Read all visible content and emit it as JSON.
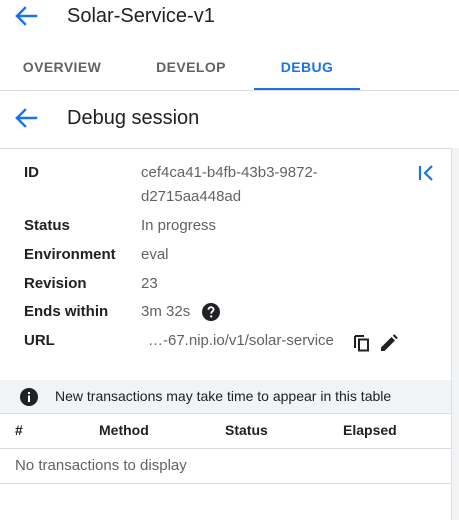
{
  "header": {
    "title": "Solar-Service-v1",
    "back_icon": "arrow-back-icon"
  },
  "tabs": [
    {
      "label": "OVERVIEW",
      "active": false
    },
    {
      "label": "DEVELOP",
      "active": false
    },
    {
      "label": "DEBUG",
      "active": true
    }
  ],
  "debug_session": {
    "title": "Debug session",
    "fields": {
      "id": {
        "label": "ID",
        "value": "cef4ca41-b4fb-43b3-9872-d2715aa448ad"
      },
      "status": {
        "label": "Status",
        "value": "In progress"
      },
      "environment": {
        "label": "Environment",
        "value": "eval"
      },
      "revision": {
        "label": "Revision",
        "value": "23"
      },
      "ends_within": {
        "label": "Ends within",
        "value": "3m 32s"
      },
      "url": {
        "label": "URL",
        "value": "…-67.nip.io/v1/solar-service"
      }
    }
  },
  "notice": {
    "text": "New transactions may take time to appear in this table"
  },
  "table": {
    "columns": [
      "#",
      "Method",
      "Status",
      "Elapsed"
    ],
    "empty_message": "No transactions to display"
  },
  "colors": {
    "accent": "#1a73e8",
    "text": "#202124",
    "muted": "#5f6368",
    "divider": "#dadce0"
  }
}
